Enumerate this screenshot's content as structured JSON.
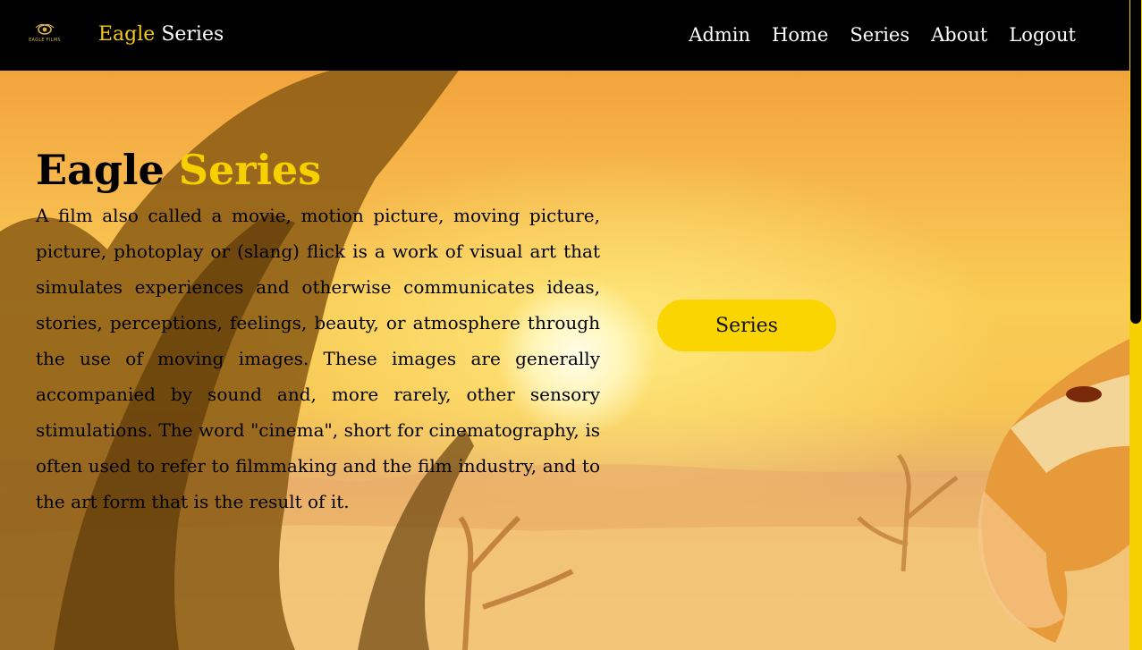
{
  "navbar": {
    "logo_text": "EAGLE FILMS",
    "brand_accent": "Eagle",
    "brand_rest": "Series",
    "links": [
      {
        "label": "Admin"
      },
      {
        "label": "Home"
      },
      {
        "label": "Series"
      },
      {
        "label": "About"
      },
      {
        "label": "Logout"
      }
    ]
  },
  "hero": {
    "title_main": "Eagle",
    "title_accent": "Series",
    "description": "A film also called a movie, motion picture, moving picture, picture, photoplay or (slang) flick is a work of visual art that simulates experiences and otherwise communicates ideas, stories, perceptions, feelings, beauty, or atmosphere through the use of moving images. These images are generally accompanied by sound and, more rarely, other sensory stimulations. The word \"cinema\", short for cinematography, is often used to refer to filmmaking and the film industry, and to the art form that is the result of it.",
    "button_label": "Series"
  },
  "colors": {
    "accent": "#f7c815",
    "button": "#fad500",
    "navbar": "#000000"
  }
}
